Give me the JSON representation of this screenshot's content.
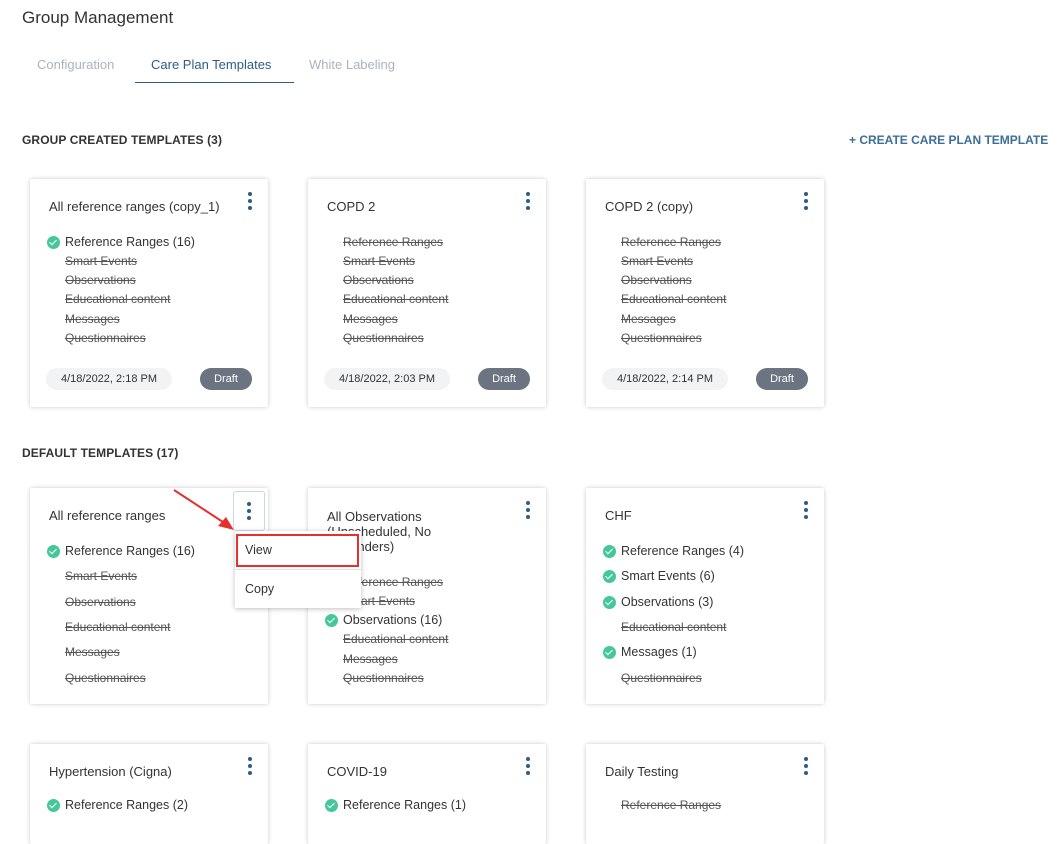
{
  "page": {
    "title": "Group Management"
  },
  "tabs": [
    {
      "label": "Configuration"
    },
    {
      "label": "Care Plan Templates"
    },
    {
      "label": "White Labeling"
    }
  ],
  "group_section": {
    "heading": "GROUP CREATED TEMPLATES (3)",
    "create_label": "+ CREATE CARE PLAN TEMPLATE"
  },
  "default_section": {
    "heading": "DEFAULT TEMPLATES (17)"
  },
  "group_cards": [
    {
      "title": "All reference ranges (copy_1)",
      "items": [
        "Reference Ranges (16)",
        "Smart Events",
        "Observations",
        "Educational content",
        "Messages",
        "Questionnaires"
      ],
      "date": "4/18/2022, 2:18 PM",
      "status": "Draft"
    },
    {
      "title": "COPD 2",
      "items": [
        "Reference Ranges",
        "Smart Events",
        "Observations",
        "Educational content",
        "Messages",
        "Questionnaires"
      ],
      "date": "4/18/2022, 2:03 PM",
      "status": "Draft"
    },
    {
      "title": "COPD 2 (copy)",
      "items": [
        "Reference Ranges",
        "Smart Events",
        "Observations",
        "Educational content",
        "Messages",
        "Questionnaires"
      ],
      "date": "4/18/2022, 2:14 PM",
      "status": "Draft"
    }
  ],
  "default_cards": [
    {
      "title": "All reference ranges",
      "items": [
        "Reference Ranges (16)",
        "Smart Events",
        "Observations",
        "Educational content",
        "Messages",
        "Questionnaires"
      ]
    },
    {
      "title": "All Observations (Unscheduled, No Reminders)",
      "items": [
        "Reference Ranges",
        "Smart Events",
        "Observations (16)",
        "Educational content",
        "Messages",
        "Questionnaires"
      ]
    },
    {
      "title": "CHF",
      "items": [
        "Reference Ranges (4)",
        "Smart Events (6)",
        "Observations (3)",
        "Educational content",
        "Messages (1)",
        "Questionnaires"
      ]
    },
    {
      "title": "Hypertension (Cigna)",
      "items": [
        "Reference Ranges (2)"
      ]
    },
    {
      "title": "COVID-19",
      "items": [
        "Reference Ranges (1)"
      ]
    },
    {
      "title": "Daily Testing",
      "items": [
        "Reference Ranges"
      ]
    }
  ],
  "context_menu": {
    "items": [
      "View",
      "Copy"
    ]
  },
  "colors": {
    "accent": "#2d5c85",
    "check": "#45c79a",
    "draft_pill": "#6b7480",
    "annotation": "#e53030"
  },
  "icons": {
    "kebab": "more-vertical-icon",
    "check": "check-circle-icon"
  }
}
